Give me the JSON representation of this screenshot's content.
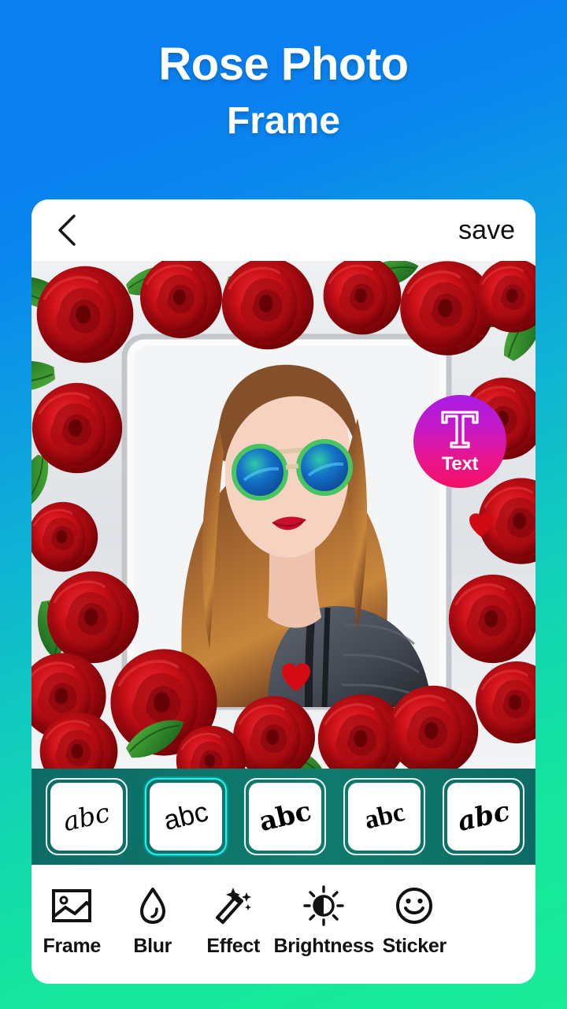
{
  "app": {
    "title_line1": "Rose Photo",
    "title_line2": "Frame",
    "background_gradient_start": "#0a7ff0",
    "background_gradient_end": "#18eb99"
  },
  "editor": {
    "back_icon": "chevron-left-icon",
    "save_label": "save",
    "photo": {
      "description": "Woman with long auburn hair wearing green round mirrored sunglasses and a grey puffer jacket, surrounded by a red rose and green leaf photo frame",
      "frame_theme": "red-roses"
    },
    "font_picker": {
      "background_color": "#0d6b66",
      "selected_index": 1,
      "selected_highlight_color": "#24f0f0",
      "items": [
        {
          "sample": "abc",
          "style": "italic-serif"
        },
        {
          "sample": "abc",
          "style": "sans"
        },
        {
          "sample": "abc",
          "style": "bold-serif"
        },
        {
          "sample": "abc",
          "style": "bold-roman"
        },
        {
          "sample": "abc",
          "style": "bold-italic-script"
        }
      ]
    },
    "toolbar": {
      "active": "Text",
      "accent_gradient_start": "#a81ce6",
      "accent_gradient_end": "#f50f66",
      "items": [
        {
          "label": "Frame",
          "icon": "image-icon"
        },
        {
          "label": "Blur",
          "icon": "droplet-icon"
        },
        {
          "label": "Effect",
          "icon": "magic-wand-icon"
        },
        {
          "label": "Brightness",
          "icon": "brightness-sun-icon"
        },
        {
          "label": "Sticker",
          "icon": "smiley-icon"
        },
        {
          "label": "Text",
          "icon": "text-t-icon"
        }
      ]
    }
  }
}
